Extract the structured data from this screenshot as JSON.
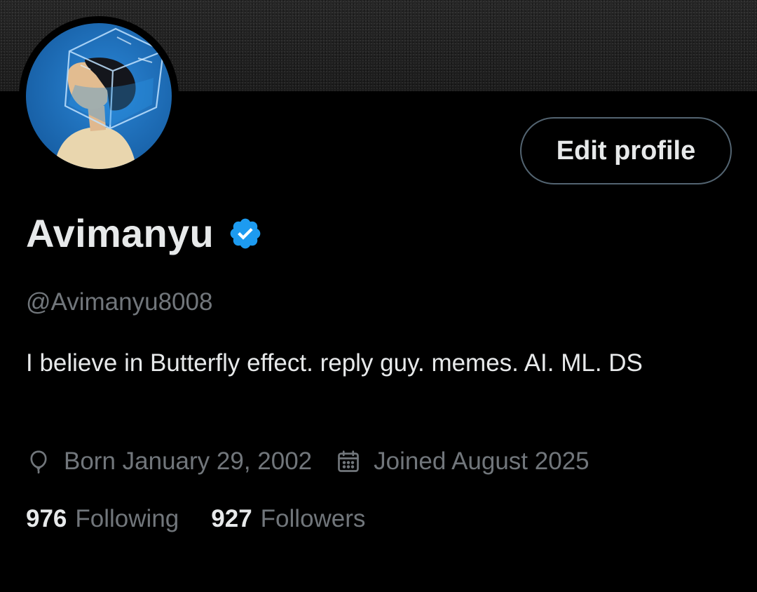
{
  "profile": {
    "display_name": "Avimanyu",
    "handle": "@Avimanyu8008",
    "bio": "I believe in Butterfly effect. reply guy. memes. AI. ML. DS",
    "verified": true,
    "verified_color": "#1d9bf0"
  },
  "actions": {
    "edit_profile_label": "Edit profile"
  },
  "meta": {
    "birth_icon": "balloon-icon",
    "born": "Born January 29, 2002",
    "joined_icon": "calendar-icon",
    "joined": "Joined August 2025"
  },
  "stats": {
    "following_count": "976",
    "following_label": "Following",
    "followers_count": "927",
    "followers_label": "Followers"
  },
  "colors": {
    "background": "#000000",
    "primary_text": "#e7e9ea",
    "secondary_text": "#71767b",
    "button_border": "#536471",
    "avatar_bg": "#1f6fb8"
  }
}
